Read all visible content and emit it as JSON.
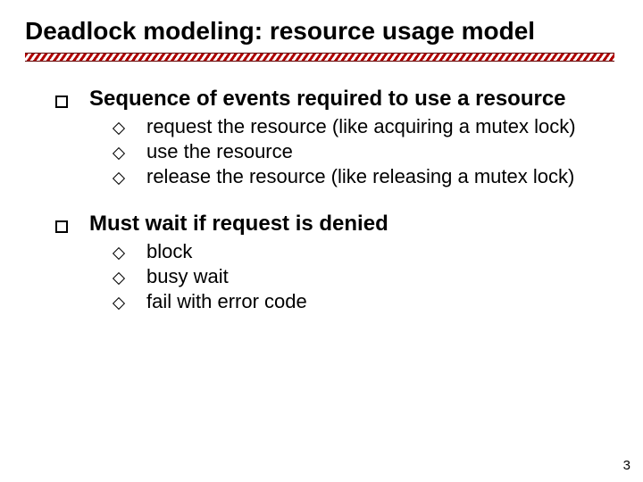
{
  "title": "Deadlock modeling: resource usage model",
  "sections": [
    {
      "heading": "Sequence of events required to use a resource",
      "items": [
        "request the resource (like acquiring a mutex lock)",
        "use the resource",
        "release the resource (like releasing a mutex lock)"
      ]
    },
    {
      "heading": "Must wait if request is denied",
      "items": [
        "block",
        "busy wait",
        "fail with error code"
      ]
    }
  ],
  "page_number": "3"
}
